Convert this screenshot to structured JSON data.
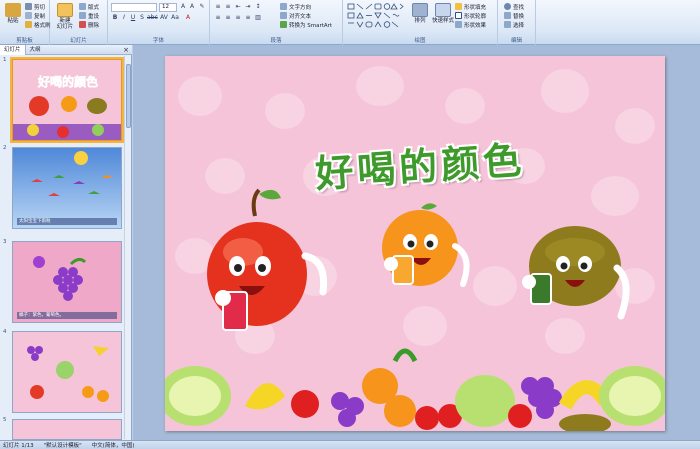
{
  "ribbon": {
    "clipboard": {
      "paste": "粘贴",
      "cut": "剪切",
      "copy": "复制",
      "format_painter": "格式刷",
      "label": "剪贴板"
    },
    "slides": {
      "new_slide": "新建",
      "new_slide_2": "幻灯片",
      "layout": "版式",
      "reset": "重设",
      "delete": "删除",
      "label": "幻灯片"
    },
    "font": {
      "font_name": "",
      "font_size": "12",
      "label": "字体"
    },
    "paragraph": {
      "text_direction": "文字方向",
      "align_text": "对齐文本",
      "smartart": "转换为 SmartArt",
      "label": "段落"
    },
    "drawing": {
      "arrange": "排列",
      "quick_styles": "快速样式",
      "shape_fill": "形状填充",
      "shape_outline": "形状轮廓",
      "shape_effects": "形状效果",
      "label": "绘图"
    },
    "editing": {
      "find": "查找",
      "replace": "替换",
      "select": "选择",
      "label": "编辑"
    }
  },
  "panel": {
    "tab_slides": "幻灯片",
    "tab_outline": "大纲",
    "close": "×",
    "thumbnails": [
      {
        "num": "1",
        "caption": ""
      },
      {
        "num": "2",
        "caption": "太阳宝宝下雨啦"
      },
      {
        "num": "3",
        "caption": "橘子：紫色，葡萄色。"
      },
      {
        "num": "4",
        "caption": ""
      },
      {
        "num": "5",
        "caption": ""
      }
    ]
  },
  "slide": {
    "title": "好喝的颜色"
  },
  "status": {
    "slide_info": "幻灯片 1/13",
    "theme": "\"默认设计模板\"",
    "language": "中文(简体，中国)"
  },
  "colors": {
    "slide_bg": "#f5c4d8",
    "title_green": "#3f9a2c",
    "ribbon_blue": "#dce8f6"
  }
}
